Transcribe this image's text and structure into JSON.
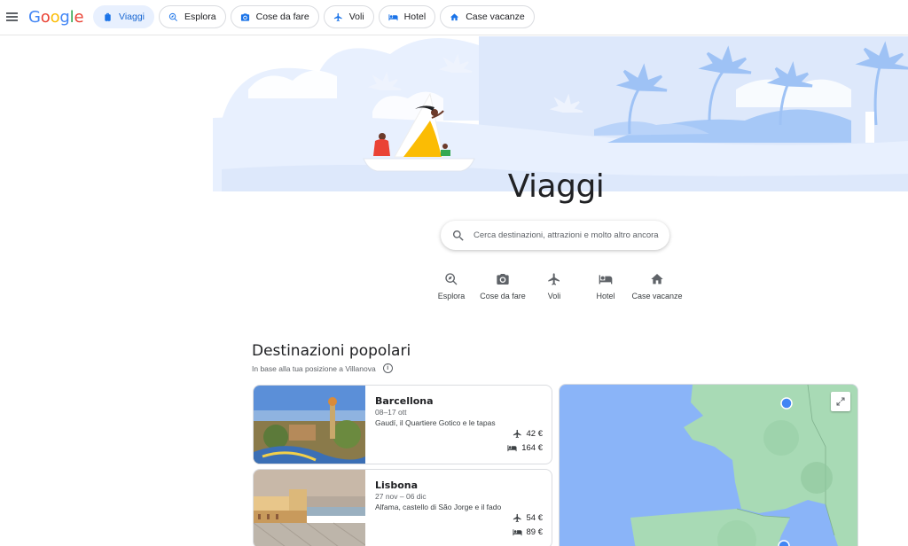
{
  "header": {
    "logo_letters": [
      {
        "ch": "G",
        "color": "#4285F4"
      },
      {
        "ch": "o",
        "color": "#EA4335"
      },
      {
        "ch": "o",
        "color": "#FBBC05"
      },
      {
        "ch": "g",
        "color": "#4285F4"
      },
      {
        "ch": "l",
        "color": "#34A853"
      },
      {
        "ch": "e",
        "color": "#EA4335"
      }
    ],
    "chips": [
      {
        "label": "Viaggi",
        "icon": "luggage-icon",
        "active": true
      },
      {
        "label": "Esplora",
        "icon": "explore-icon",
        "active": false
      },
      {
        "label": "Cose da fare",
        "icon": "camera-icon",
        "active": false
      },
      {
        "label": "Voli",
        "icon": "airplane-icon",
        "active": false
      },
      {
        "label": "Hotel",
        "icon": "bed-icon",
        "active": false
      },
      {
        "label": "Case vacanze",
        "icon": "house-icon",
        "active": false
      }
    ]
  },
  "hero": {
    "title": "Viaggi"
  },
  "search": {
    "placeholder": "Cerca destinazioni, attrazioni e molto altro ancora"
  },
  "quick_links": [
    {
      "label": "Esplora",
      "icon": "explore-icon"
    },
    {
      "label": "Cose da fare",
      "icon": "camera-icon"
    },
    {
      "label": "Voli",
      "icon": "airplane-icon"
    },
    {
      "label": "Hotel",
      "icon": "bed-icon"
    },
    {
      "label": "Case vacanze",
      "icon": "house-icon"
    }
  ],
  "popular": {
    "title": "Destinazioni popolari",
    "subtitle": "In base alla tua posizione a Villanova",
    "destinations": [
      {
        "name": "Barcellona",
        "dates": "08–17 ott",
        "description": "Gaudí, il Quartiere Gotico e le tapas",
        "flight_price": "42 €",
        "hotel_price": "164 €"
      },
      {
        "name": "Lisbona",
        "dates": "27 nov – 06 dic",
        "description": "Alfama, castello di São Jorge e il fado",
        "flight_price": "54 €",
        "hotel_price": "89 €"
      }
    ]
  },
  "colors": {
    "accent": "#1a73e8",
    "chip_active_bg": "#e8f0fe",
    "map_sea": "#8ab4f8",
    "map_land": "#a8dab5",
    "map_marker": "#4285f4"
  }
}
